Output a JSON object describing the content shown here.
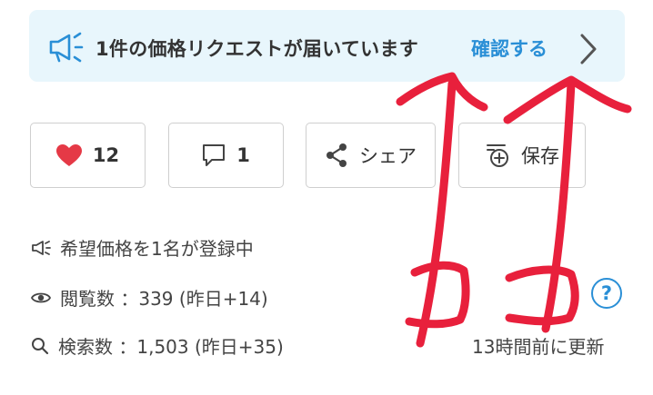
{
  "banner": {
    "icon": "megaphone-icon",
    "text": "1件の価格リクエストが届いています",
    "link_label": "確認する",
    "chevron": "chevron-right-icon",
    "accent": "#2a8fd6",
    "background": "#e8f6fc"
  },
  "actions": [
    {
      "id": "like",
      "icon": "heart-icon",
      "label": "12",
      "color": "#e53946"
    },
    {
      "id": "comment",
      "icon": "comment-icon",
      "label": "1"
    },
    {
      "id": "share",
      "icon": "share-icon",
      "label": "シェア"
    },
    {
      "id": "save",
      "icon": "save-list-icon",
      "label": "保存"
    }
  ],
  "stats": {
    "price_request": {
      "icon": "megaphone-icon",
      "text": "希望価格を1名が登録中"
    },
    "views": {
      "icon": "eye-icon",
      "text": "閲覧数 ：339 (昨日+14)"
    },
    "searches": {
      "icon": "search-icon",
      "text": "検索数 ：1,503 (昨日+35)"
    },
    "help_icon": "?",
    "updated": "13時間前に更新"
  },
  "annotation": {
    "color": "#e8203c"
  }
}
